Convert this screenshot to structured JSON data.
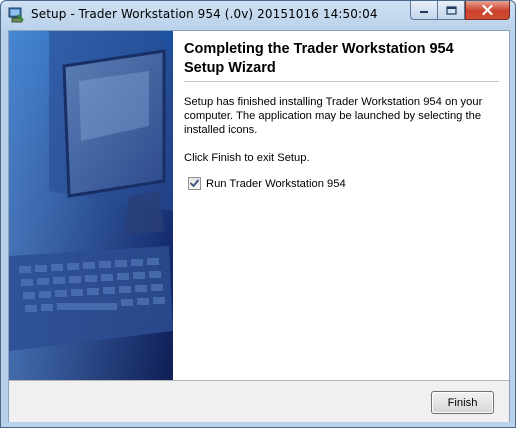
{
  "window": {
    "title": "Setup - Trader Workstation 954 (.0v) 20151016 14:50:04",
    "icon": "setup-app-icon",
    "controls": [
      "minimize-icon",
      "maximize-icon",
      "close-icon"
    ]
  },
  "sidebar": {
    "image": "computer-monitor-keyboard-graphic"
  },
  "content": {
    "heading": "Completing the Trader Workstation 954 Setup Wizard",
    "paragraph1": "Setup has finished installing Trader Workstation 954 on your computer. The application may be launched by selecting the installed icons.",
    "paragraph2": "Click Finish to exit Setup.",
    "run_checkbox": {
      "label": "Run Trader Workstation 954",
      "checked": true
    }
  },
  "footer": {
    "finish_label": "Finish"
  },
  "colors": {
    "titlebar": "#b9d1ea",
    "sidebar_top": "#1c5fb4",
    "sidebar_bottom": "#0f1e55",
    "close_button": "#c9412b"
  }
}
